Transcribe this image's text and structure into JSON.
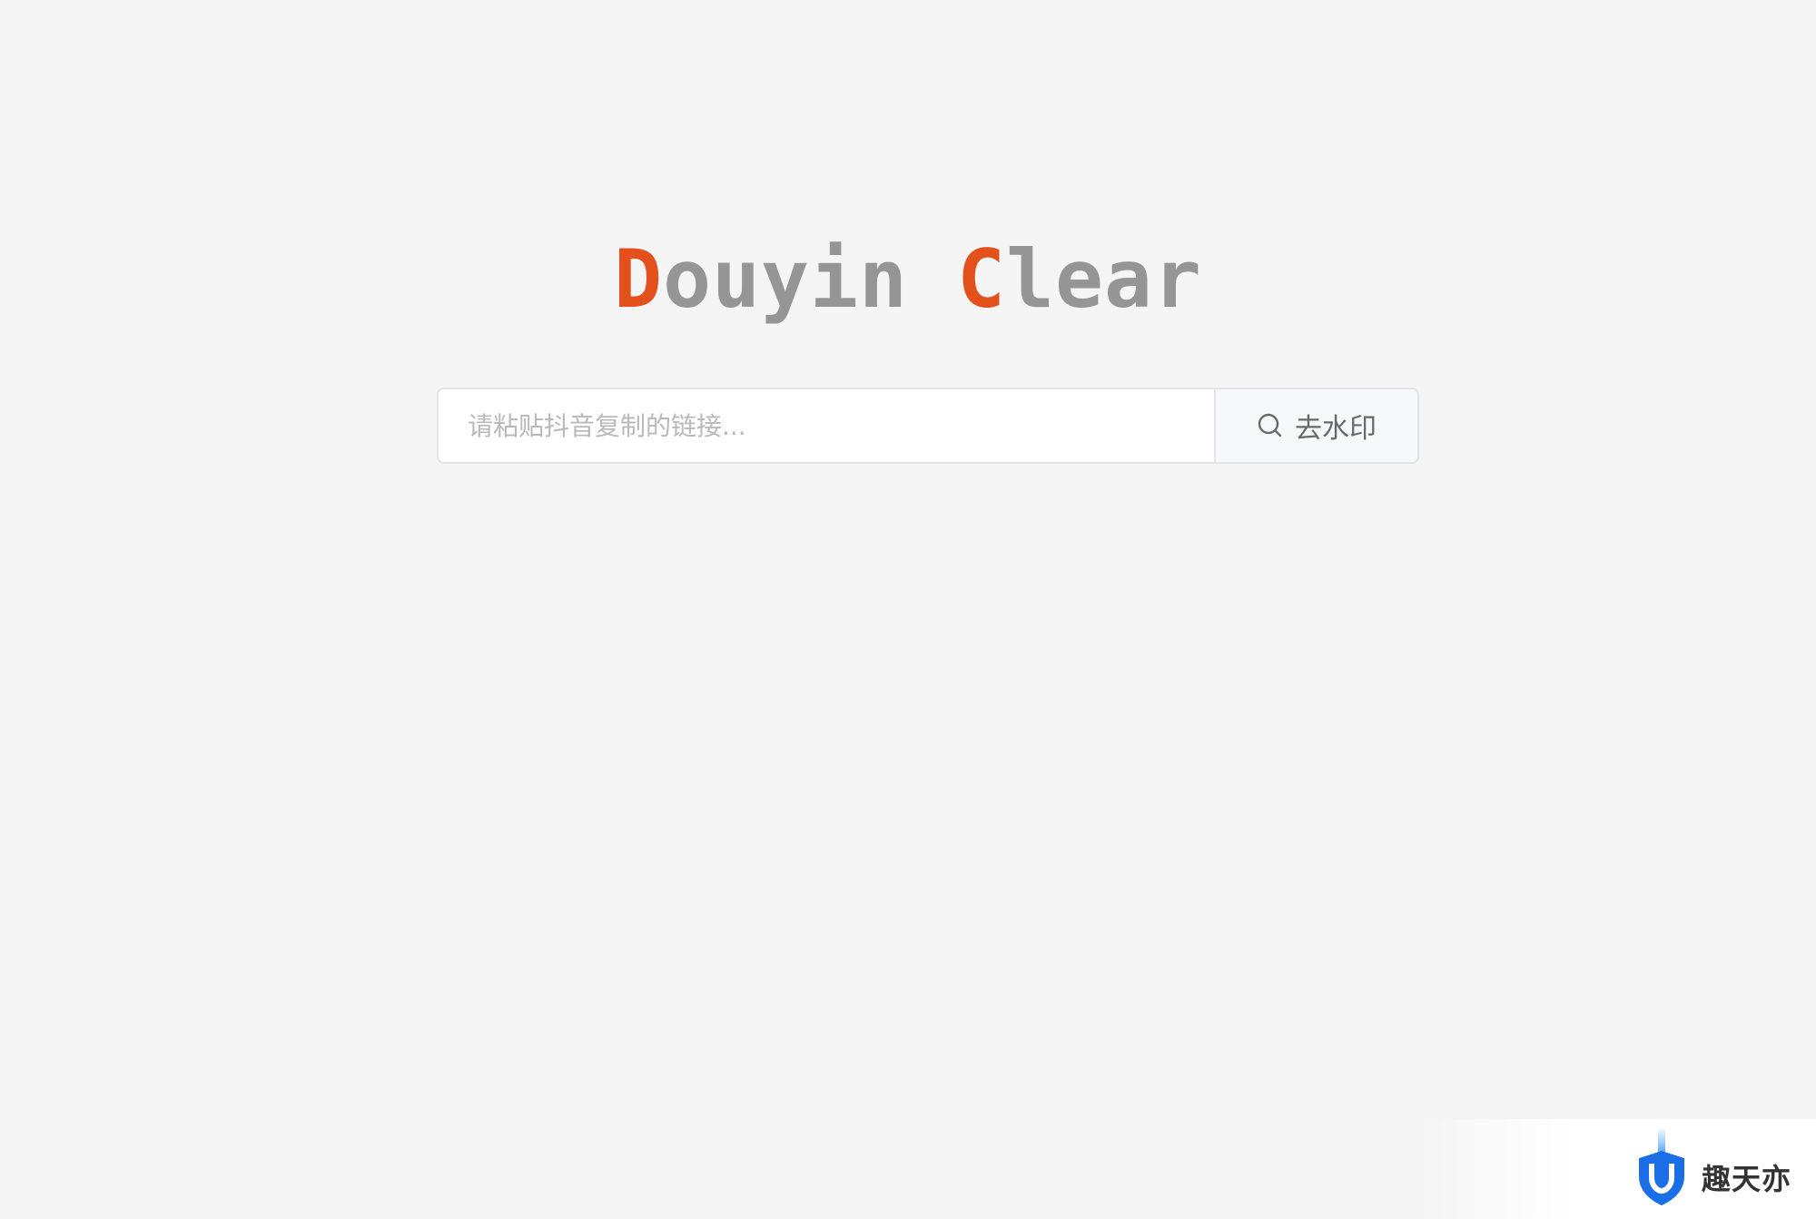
{
  "title": {
    "first_initial": "D",
    "first_rest": "ouyin",
    "second_initial": "C",
    "second_rest": "lear",
    "accent_color": "#e4501c",
    "text_color": "#959595"
  },
  "search": {
    "placeholder": "请粘贴抖音复制的链接...",
    "value": "",
    "button_label": "去水印",
    "button_icon": "search-icon"
  },
  "watermark": {
    "text": "趣天亦",
    "icon": "shield-logo-icon",
    "color": "#1677ff"
  }
}
